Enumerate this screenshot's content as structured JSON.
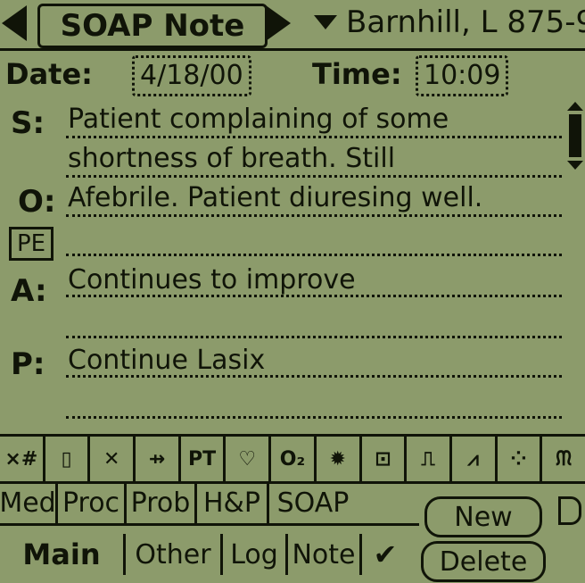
{
  "header": {
    "title": "SOAP Note",
    "patient": "Barnhill, L 875-9"
  },
  "datetime": {
    "date_label": "Date:",
    "date_value": "4/18/00",
    "time_label": "Time:",
    "time_value": "10:09"
  },
  "note": {
    "s_label": "S:",
    "s_line1": "Patient complaining of some",
    "s_line2": "shortness of breath.  Still",
    "o_label": "O:",
    "o_line1": "Afebrile.  Patient diuresing well.",
    "pe_label": "PE",
    "a_label": "A:",
    "a_line1": "Continues to improve",
    "p_label": "P:",
    "p_line1": "Continue Lasix"
  },
  "iconbar": [
    {
      "name": "calculator-icon",
      "glyph": "×#"
    },
    {
      "name": "iv-bag-icon",
      "glyph": "▯"
    },
    {
      "name": "crossing-lines-icon",
      "glyph": "✕"
    },
    {
      "name": "antibiotic-icon",
      "glyph": "⇸"
    },
    {
      "name": "pt-ptt-icon",
      "glyph": "PT"
    },
    {
      "name": "heart-icon",
      "glyph": "♡"
    },
    {
      "name": "oxygen-icon",
      "glyph": "O₂"
    },
    {
      "name": "bug-icon",
      "glyph": "✹"
    },
    {
      "name": "box-face-icon",
      "glyph": "⊡"
    },
    {
      "name": "pulse-icon",
      "glyph": "⎍"
    },
    {
      "name": "waveform-icon",
      "glyph": "⩘"
    },
    {
      "name": "scatter-icon",
      "glyph": "⁘"
    },
    {
      "name": "lungs-icon",
      "glyph": "ᙏ"
    }
  ],
  "row1": {
    "med": "Med",
    "proc": "Proc",
    "prob": "Prob",
    "hp": "H&P",
    "soap": "SOAP",
    "new": "New"
  },
  "row2": {
    "main": "Main",
    "other": "Other",
    "log": "Log",
    "note": "Note",
    "check": "✔",
    "delete": "Delete"
  },
  "colors": {
    "background": "#8c9b6b",
    "ink": "#101408"
  }
}
